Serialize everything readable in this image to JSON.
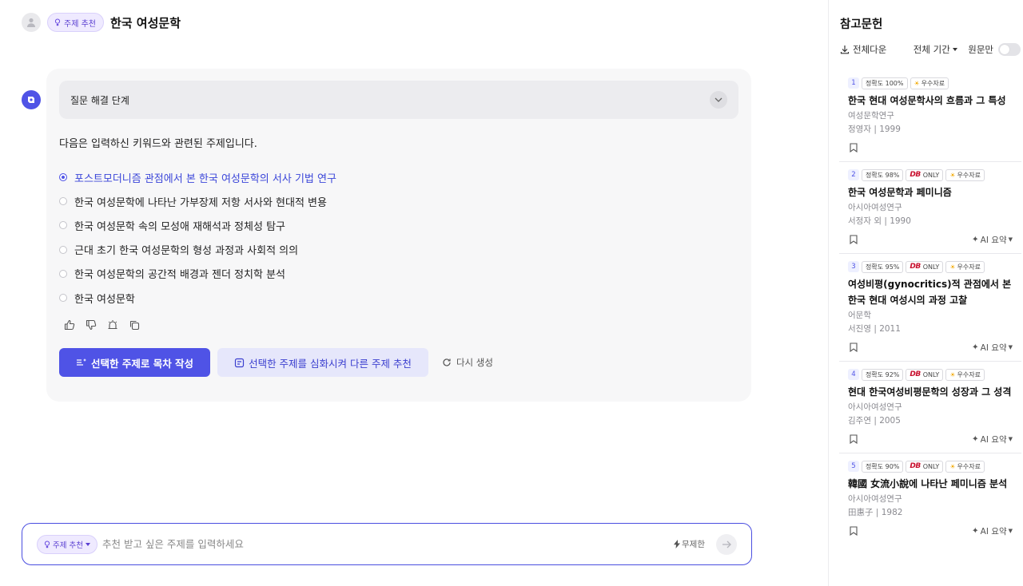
{
  "header": {
    "mode_chip": "주제 추천",
    "title": "한국 여성문학"
  },
  "answer": {
    "steps_label": "질문 해결 단계",
    "intro": "다음은 입력하신 키워드와 관련된 주제입니다.",
    "options": [
      "포스트모더니즘 관점에서 본 한국 여성문학의 서사 기법 연구",
      "한국 여성문학에 나타난 가부장제 저항 서사와 현대적 변용",
      "한국 여성문학 속의 모성애 재해석과 정체성 탐구",
      "근대 초기 한국 여성문학의 형성 과정과 사회적 의의",
      "한국 여성문학의 공간적 배경과 젠더 정치학 분석",
      "한국 여성문학"
    ],
    "selected_index": 0,
    "actions": {
      "outline": "선택한 주제로 목차 작성",
      "deepen": "선택한 주제를 심화시켜 다른 주제 추천",
      "regenerate": "다시 생성"
    }
  },
  "input": {
    "mode_chip": "주제 추천",
    "placeholder": "추천 받고 싶은 주제를 입력하세요",
    "unlimited": "무제한"
  },
  "references": {
    "title": "참고문헌",
    "download_all": "전체다운",
    "period": "전체 기간",
    "original_only": "원문만",
    "items": [
      {
        "num": "1",
        "accuracy": "정확도 100%",
        "db_only": false,
        "excellent": "우수자료",
        "title": "한국 현대 여성문학사의 흐름과 그 특성",
        "journal": "여성문학연구",
        "meta": "정영자 | 1999",
        "ai_summary": ""
      },
      {
        "num": "2",
        "accuracy": "정확도 98%",
        "db_only": true,
        "db_text": "ONLY",
        "excellent": "우수자료",
        "title": "한국 여성문학과 페미니즘",
        "journal": "아시아여성연구",
        "meta": "서정자 외 | 1990",
        "ai_summary": "AI 요약"
      },
      {
        "num": "3",
        "accuracy": "정확도 95%",
        "db_only": true,
        "db_text": "ONLY",
        "excellent": "우수자료",
        "title": "여성비평(gynocritics)적 관점에서 본 한국 현대 여성시의 과정 고찰",
        "journal": "어문학",
        "meta": "서진영 | 2011",
        "ai_summary": "AI 요약"
      },
      {
        "num": "4",
        "accuracy": "정확도 92%",
        "db_only": true,
        "db_text": "ONLY",
        "excellent": "우수자료",
        "title": "현대 한국여성비평문학의 성장과 그 성격",
        "journal": "아시아여성연구",
        "meta": "김주연 | 2005",
        "ai_summary": "AI 요약"
      },
      {
        "num": "5",
        "accuracy": "정확도 90%",
        "db_only": true,
        "db_text": "ONLY",
        "excellent": "우수자료",
        "title": "韓國 女流小說에 나타난 페미니즘 분석",
        "journal": "아시아여성연구",
        "meta": "田惠子 | 1982",
        "ai_summary": "AI 요약"
      }
    ]
  },
  "colors": {
    "accent": "#4f53e6",
    "chip_bg": "#efeaff",
    "db_red": "#c8102e"
  }
}
